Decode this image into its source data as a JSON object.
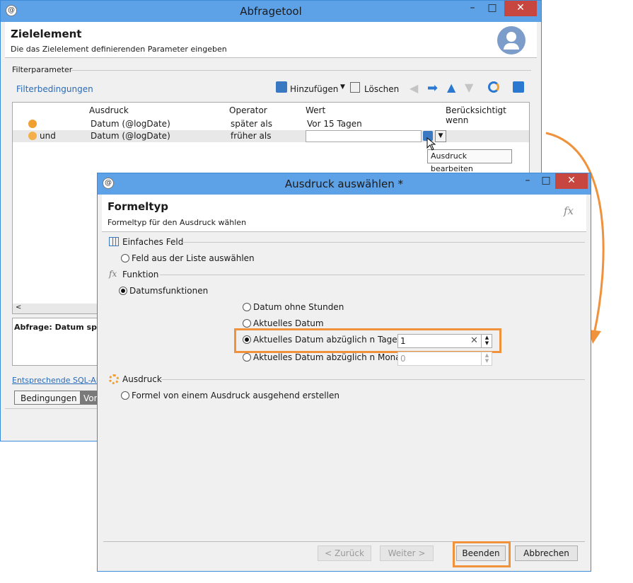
{
  "back": {
    "title": "Abfragetool",
    "header_title": "Zielelement",
    "header_subtitle": "Die das Zielelement definierenden Parameter eingeben",
    "filter_section": "Filterparameter",
    "filter_link": "Filterbedingungen",
    "add_label": "Hinzufügen",
    "delete_label": "Löschen",
    "columns": [
      "Ausdruck",
      "Operator",
      "Wert",
      "Berücksichtigt wenn"
    ],
    "rows": [
      {
        "conj": "",
        "expr": "Datum (@logDate)",
        "op": "später als",
        "value": "Vor 15 Tagen"
      },
      {
        "conj": "und",
        "expr": "Datum (@logDate)",
        "op": "früher als",
        "value": ""
      }
    ],
    "tooltip": "Ausdruck bearbeiten",
    "query_label": "Abfrage: Datum späte",
    "sql_link": "Entsprechende SQL-Ab",
    "tab_conditions": "Bedingungen",
    "tab_second": "Vor"
  },
  "dialog": {
    "title": "Ausdruck auswählen *",
    "header_title": "Formeltyp",
    "header_subtitle": "Formeltyp für den Ausdruck wählen",
    "fx": "fx",
    "section_simple": "Einfaches Feld",
    "opt_field_list": "Feld aus der Liste auswählen",
    "section_function": "Funktion",
    "opt_date_functions": "Datumsfunktionen",
    "opt_date_no_hours": "Datum ohne Stunden",
    "opt_current_date": "Aktuelles Datum",
    "opt_minus_days": "Aktuelles Datum abzüglich n Tage",
    "days_value": "1",
    "opt_minus_months": "Aktuelles Datum abzüglich n Monate",
    "months_value": "0",
    "section_expression": "Ausdruck",
    "opt_formula": "Formel von einem Ausdruck ausgehend erstellen",
    "btn_back": "< Zurück",
    "btn_next": "Weiter >",
    "btn_finish": "Beenden",
    "btn_cancel": "Abbrechen"
  },
  "colors": {
    "accent": "#3c8bd8",
    "highlight": "#f0913c",
    "close": "#c7463f"
  }
}
